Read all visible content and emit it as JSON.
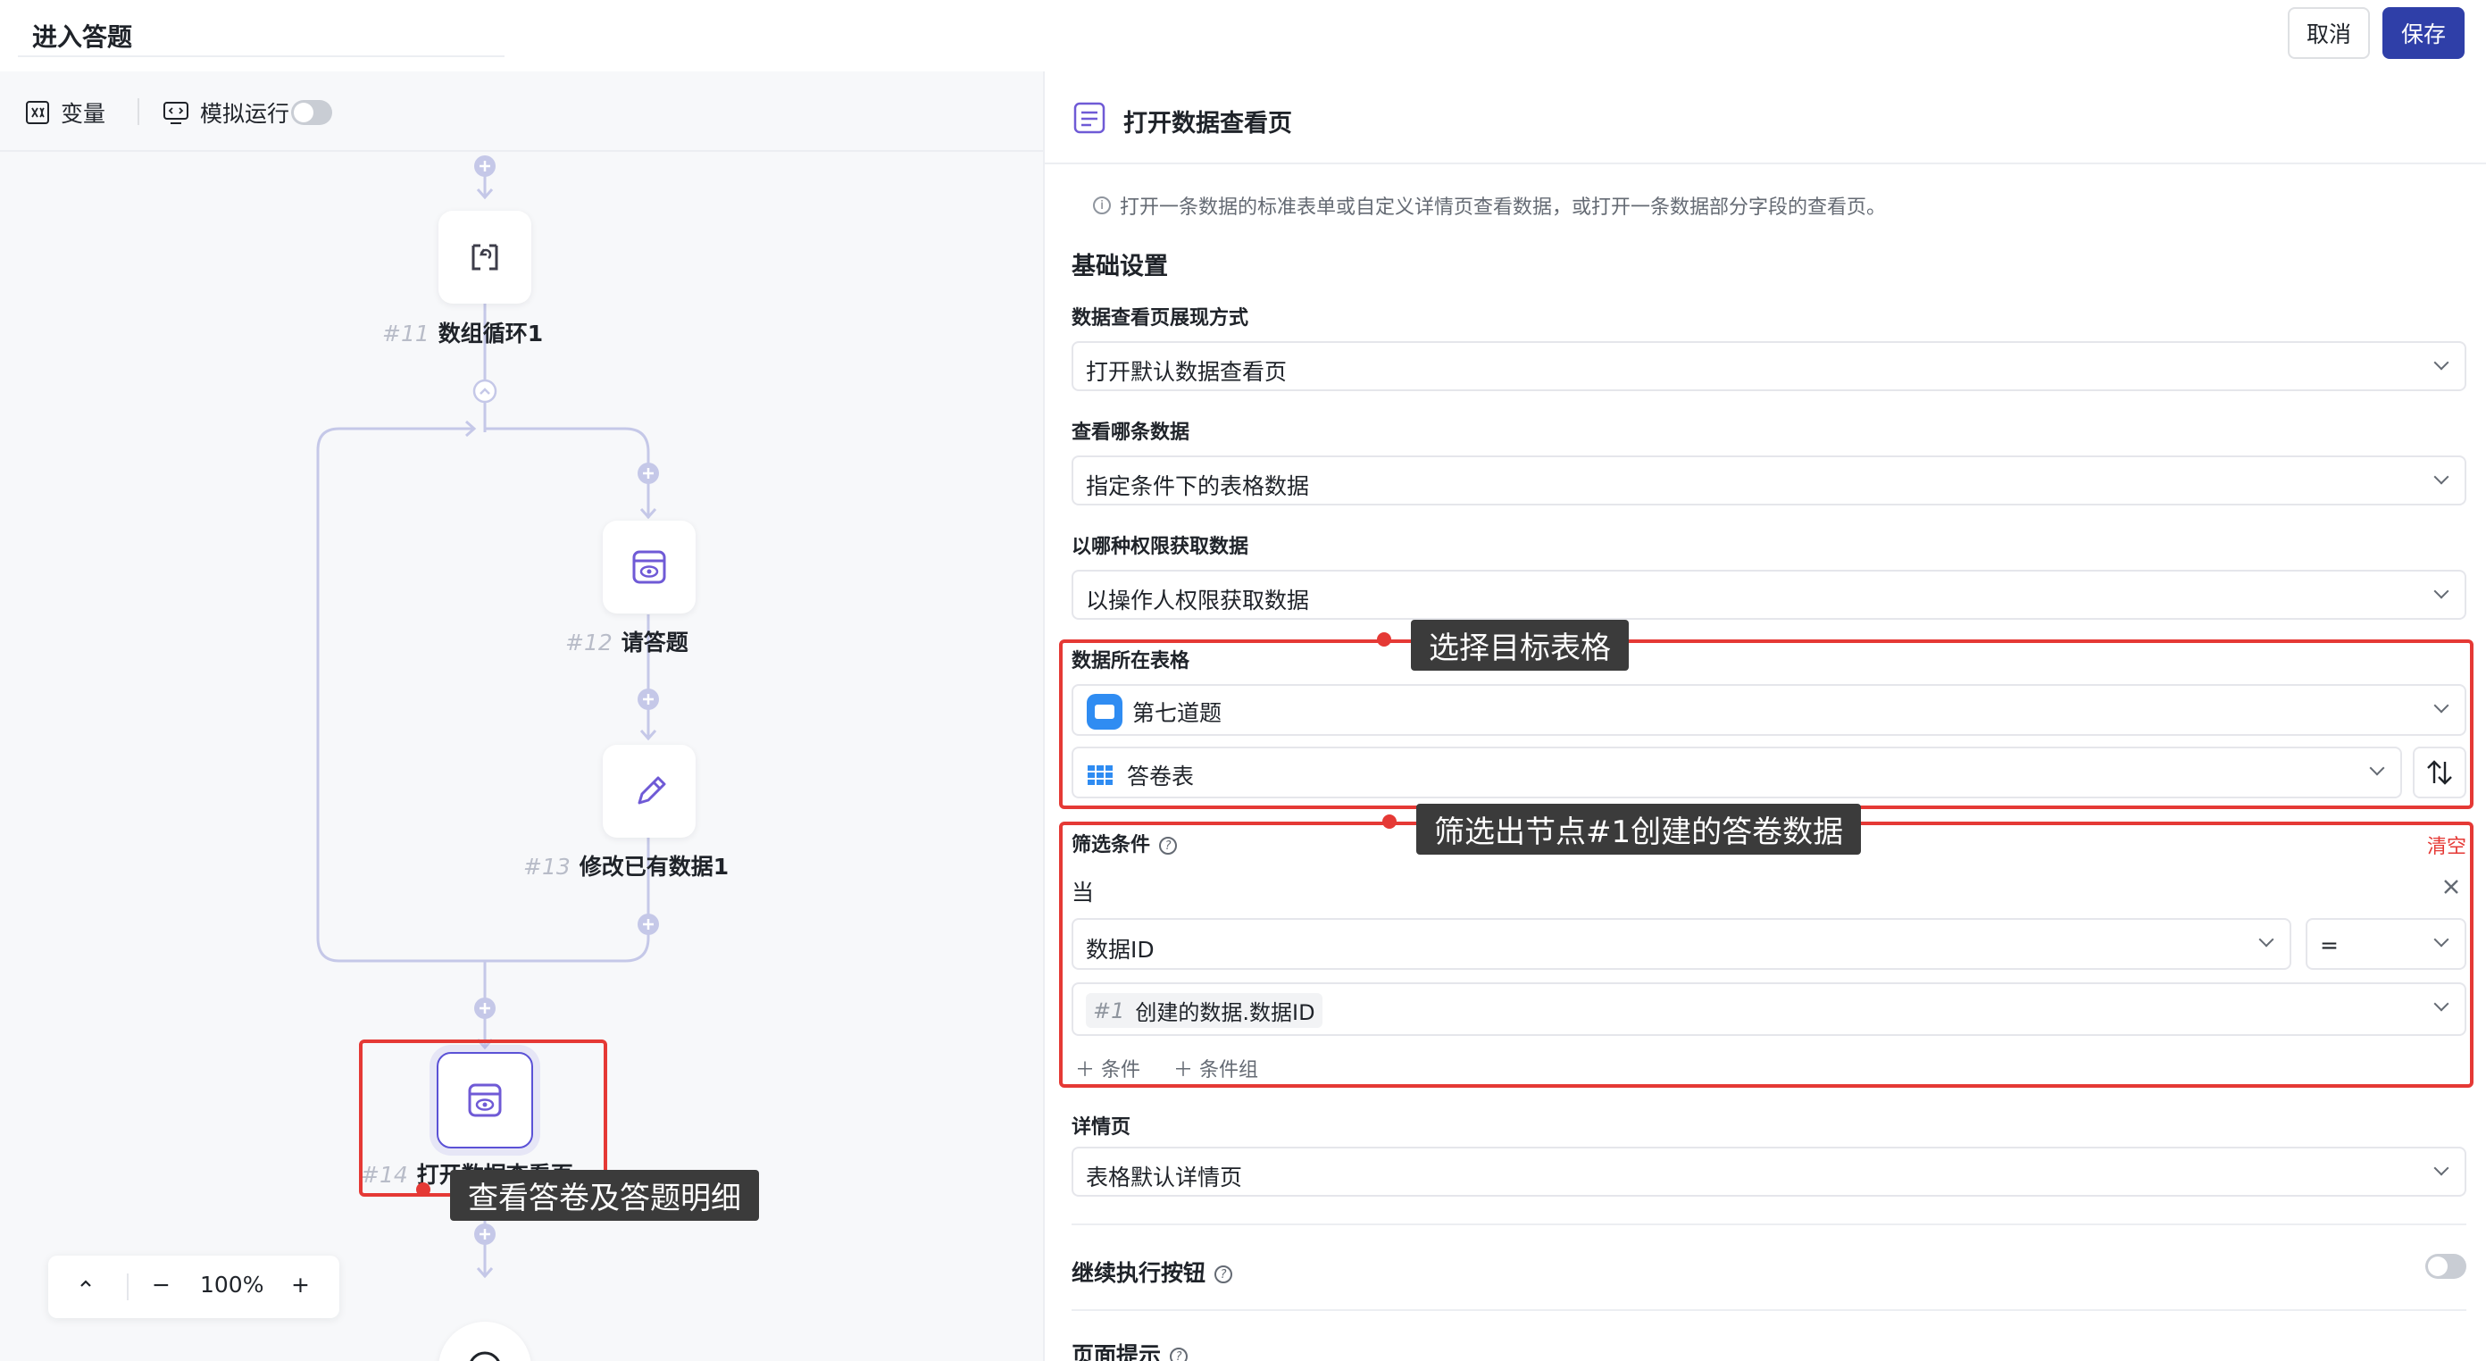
{
  "header": {
    "title": "进入答题",
    "cancel_label": "取消",
    "save_label": "保存"
  },
  "toolbar": {
    "variables_label": "变量",
    "simulate_label": "模拟运行",
    "simulate_on": false
  },
  "workflow": {
    "nodes": [
      {
        "num": "#11",
        "label": "数组循环1",
        "icon": "loop-icon"
      },
      {
        "num": "#12",
        "label": "请答题",
        "icon": "view-page-icon"
      },
      {
        "num": "#13",
        "label": "修改已有数据1",
        "icon": "edit-pencil-icon"
      },
      {
        "num": "#14",
        "label": "打开数据查看页",
        "icon": "view-page-icon"
      }
    ],
    "end_icon": "stop-icon"
  },
  "zoom": {
    "value": "100%",
    "collapse_icon": "chevron-up-icon",
    "minus": "−",
    "plus": "+"
  },
  "panel": {
    "title": "打开数据查看页",
    "description": "打开一条数据的标准表单或自定义详情页查看数据，或打开一条数据部分字段的查看页。",
    "basic_section": "基础设置",
    "display_mode": {
      "label": "数据查看页展现方式",
      "value": "打开默认数据查看页"
    },
    "which_data": {
      "label": "查看哪条数据",
      "value": "指定条件下的表格数据"
    },
    "permission": {
      "label": "以哪种权限获取数据",
      "value": "以操作人权限获取数据"
    },
    "table": {
      "label": "数据所在表格",
      "app": "第七道题",
      "sheet": "答卷表"
    },
    "filter": {
      "label": "筛选条件",
      "clear": "清空",
      "when": "当",
      "field": "数据ID",
      "operator": "=",
      "value_num": "#1",
      "value_text": "创建的数据.数据ID",
      "add_condition": "条件",
      "add_group": "条件组"
    },
    "detail": {
      "label": "详情页",
      "value": "表格默认详情页"
    },
    "continue_button": {
      "label": "继续执行按钮",
      "enabled": false
    },
    "page_tip": {
      "label": "页面提示"
    }
  },
  "annotations": {
    "select_table": "选择目标表格",
    "filter_node": "筛选出节点#1创建的答卷数据",
    "view_detail": "查看答卷及答题明细"
  },
  "colors": {
    "accent": "#2f3fa8",
    "node_purple": "#5b52d6",
    "annotation_red": "#e53935",
    "callout_bg": "#3b3b3b"
  }
}
